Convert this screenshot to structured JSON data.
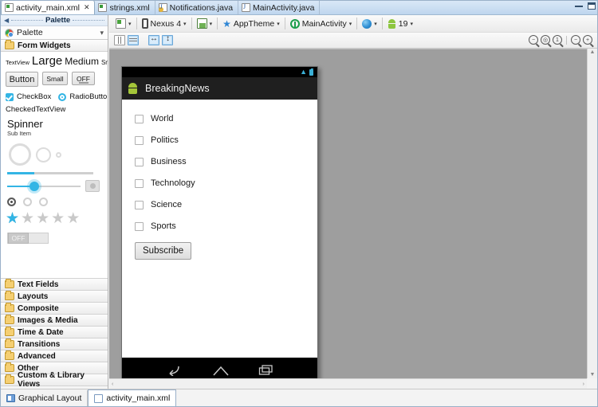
{
  "window": {
    "minimize_label": "Minimize",
    "restore_label": "Restore"
  },
  "editor_tabs": [
    {
      "label": "activity_main.xml",
      "icon": "xml-file-icon",
      "active": true,
      "close": "✕"
    },
    {
      "label": "strings.xml",
      "icon": "xml-file-icon",
      "active": false
    },
    {
      "label": "Notifications.java",
      "icon": "java-file-warning-icon",
      "active": false
    },
    {
      "label": "MainActivity.java",
      "icon": "java-file-icon",
      "active": false
    }
  ],
  "palette": {
    "panel_title": "Palette",
    "header_label": "Palette",
    "header_icon": "chrome-icon",
    "collapse_icon": "collapse-left-icon",
    "chevron_icon": "chevron-down-icon",
    "group": {
      "label": "Form Widgets",
      "icon": "folder-icon"
    },
    "textview_row": {
      "textview": "TextView",
      "large": "Large",
      "medium": "Medium",
      "small": "Small"
    },
    "buttons": {
      "button": "Button",
      "small": "Small",
      "toggle": "OFF"
    },
    "checkbox_label": "CheckBox",
    "radiobutton_label": "RadioButton",
    "checkedtextview_label": "CheckedTextView",
    "spinner": {
      "title": "Spinner",
      "subtitle": "Sub Item"
    },
    "switch_label": "OFF",
    "categories": [
      {
        "label": "Text Fields",
        "icon": "folder-icon"
      },
      {
        "label": "Layouts",
        "icon": "folder-icon"
      },
      {
        "label": "Composite",
        "icon": "folder-icon"
      },
      {
        "label": "Images & Media",
        "icon": "folder-icon"
      },
      {
        "label": "Time & Date",
        "icon": "folder-icon"
      },
      {
        "label": "Transitions",
        "icon": "folder-icon"
      },
      {
        "label": "Advanced",
        "icon": "folder-icon"
      },
      {
        "label": "Other",
        "icon": "folder-icon"
      },
      {
        "label": "Custom & Library Views",
        "icon": "folder-icon"
      }
    ]
  },
  "toolbar": {
    "config": {
      "label": "",
      "icon": "configuration-icon"
    },
    "device": {
      "label": "Nexus 4",
      "icon": "device-icon"
    },
    "orientation": {
      "label": "",
      "icon": "orientation-icon"
    },
    "theme": {
      "label": "AppTheme",
      "icon": "theme-star-icon"
    },
    "activity": {
      "label": "MainActivity",
      "icon": "activity-icon"
    },
    "locale": {
      "label": "",
      "icon": "globe-icon"
    },
    "api": {
      "label": "19",
      "icon": "android-icon"
    },
    "caret": "▾"
  },
  "toolbar2": {
    "show_included_icon": "columns-layout-icon",
    "show_rows_icon": "rows-layout-icon",
    "fit_width_icon": "fit-width-icon",
    "fit_height_icon": "fit-height-icon",
    "zoom_out_icon": "zoom-out-icon",
    "zoom_fit_icon": "zoom-fit-icon",
    "zoom_100_icon": "zoom-100-icon",
    "zoom_minus_icon": "zoom-minus-icon",
    "zoom_plus_icon": "zoom-plus-icon",
    "zoom_out_glyph": "−",
    "zoom_fit_glyph": "◎",
    "zoom_100_glyph": "1",
    "zoom_minus_glyph": "−",
    "zoom_plus_glyph": "+"
  },
  "preview": {
    "statusbar": {
      "wifi_icon": "wifi-icon",
      "battery_icon": "battery-icon",
      "wifi_glyph": "▲"
    },
    "actionbar": {
      "app_icon": "android-app-icon",
      "title": "BreakingNews"
    },
    "checkboxes": [
      {
        "label": "World",
        "checked": false
      },
      {
        "label": "Politics",
        "checked": false
      },
      {
        "label": "Business",
        "checked": false
      },
      {
        "label": "Technology",
        "checked": false
      },
      {
        "label": "Science",
        "checked": false
      },
      {
        "label": "Sports",
        "checked": false
      }
    ],
    "subscribe_button": "Subscribe",
    "navbar": {
      "back_icon": "nav-back-icon",
      "home_icon": "nav-home-icon",
      "recents_icon": "nav-recents-icon"
    }
  },
  "scroll": {
    "up_glyph": "▲",
    "down_glyph": "▼",
    "left_glyph": "‹",
    "right_glyph": "›"
  },
  "bottom_tabs": [
    {
      "label": "Graphical Layout",
      "icon": "graphical-layout-icon",
      "active": false
    },
    {
      "label": "activity_main.xml",
      "icon": "xml-source-icon",
      "active": true
    }
  ]
}
